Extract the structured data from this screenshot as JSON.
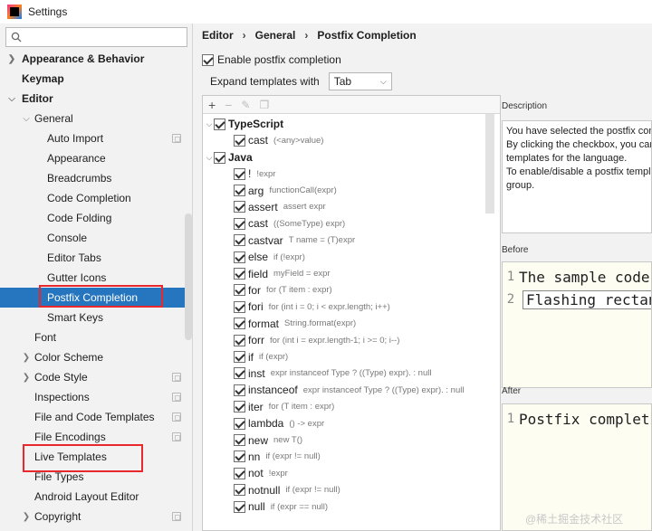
{
  "window": {
    "title": "Settings"
  },
  "search": {
    "placeholder": ""
  },
  "sidebar": {
    "items": [
      {
        "label": "Appearance & Behavior"
      },
      {
        "label": "Keymap"
      },
      {
        "label": "Editor"
      },
      {
        "label": "General"
      },
      {
        "label": "Auto Import"
      },
      {
        "label": "Appearance"
      },
      {
        "label": "Breadcrumbs"
      },
      {
        "label": "Code Completion"
      },
      {
        "label": "Code Folding"
      },
      {
        "label": "Console"
      },
      {
        "label": "Editor Tabs"
      },
      {
        "label": "Gutter Icons"
      },
      {
        "label": "Postfix Completion"
      },
      {
        "label": "Smart Keys"
      },
      {
        "label": "Font"
      },
      {
        "label": "Color Scheme"
      },
      {
        "label": "Code Style"
      },
      {
        "label": "Inspections"
      },
      {
        "label": "File and Code Templates"
      },
      {
        "label": "File Encodings"
      },
      {
        "label": "Live Templates"
      },
      {
        "label": "File Types"
      },
      {
        "label": "Android Layout Editor"
      },
      {
        "label": "Copyright"
      }
    ],
    "selected": "Postfix Completion"
  },
  "breadcrumb": {
    "items": [
      "Editor",
      "General",
      "Postfix Completion"
    ]
  },
  "options": {
    "enable_label": "Enable postfix completion",
    "enable_checked": true,
    "expand_label": "Expand templates with",
    "expand_value": "Tab"
  },
  "templates": {
    "groups": [
      {
        "label": "TypeScript",
        "checked": true,
        "items": [
          {
            "key": "cast",
            "desc": "(<any>value)"
          }
        ]
      },
      {
        "label": "Java",
        "checked": true,
        "items": [
          {
            "key": "!",
            "desc": "!expr"
          },
          {
            "key": "arg",
            "desc": "functionCall(expr)"
          },
          {
            "key": "assert",
            "desc": "assert expr"
          },
          {
            "key": "cast",
            "desc": "((SomeType) expr)"
          },
          {
            "key": "castvar",
            "desc": "T name = (T)expr"
          },
          {
            "key": "else",
            "desc": "if (!expr)"
          },
          {
            "key": "field",
            "desc": "myField = expr"
          },
          {
            "key": "for",
            "desc": "for (T item : expr)"
          },
          {
            "key": "fori",
            "desc": "for (int i = 0; i < expr.length; i++)"
          },
          {
            "key": "format",
            "desc": "String.format(expr)"
          },
          {
            "key": "forr",
            "desc": "for (int i = expr.length-1; i >= 0; i--)"
          },
          {
            "key": "if",
            "desc": "if (expr)"
          },
          {
            "key": "inst",
            "desc": "expr instanceof Type ? ((Type) expr). : null"
          },
          {
            "key": "instanceof",
            "desc": "expr instanceof Type ? ((Type) expr). : null"
          },
          {
            "key": "iter",
            "desc": "for (T item : expr)"
          },
          {
            "key": "lambda",
            "desc": "() -> expr"
          },
          {
            "key": "new",
            "desc": "new T()"
          },
          {
            "key": "nn",
            "desc": "if (expr != null)"
          },
          {
            "key": "not",
            "desc": "!expr"
          },
          {
            "key": "notnull",
            "desc": "if (expr != null)"
          },
          {
            "key": "null",
            "desc": "if (expr == null)"
          }
        ]
      }
    ]
  },
  "description": {
    "label": "Description",
    "lines": [
      "You have selected the postfix completion",
      "By clicking the checkbox, you can enable/disable",
      "templates for the language.",
      "To enable/disable a postfix template, use the",
      "group."
    ]
  },
  "before": {
    "label": "Before",
    "lines": [
      {
        "no": "1",
        "text": "The sample code"
      },
      {
        "no": "2",
        "text": "Flashing rectangle"
      }
    ]
  },
  "after": {
    "label": "After",
    "lines": [
      {
        "no": "1",
        "text": "Postfix completion"
      }
    ]
  },
  "watermark": "@稀土掘金技术社区",
  "colors": {
    "selection": "#2675bf",
    "highlight_box": "#e8282d"
  }
}
